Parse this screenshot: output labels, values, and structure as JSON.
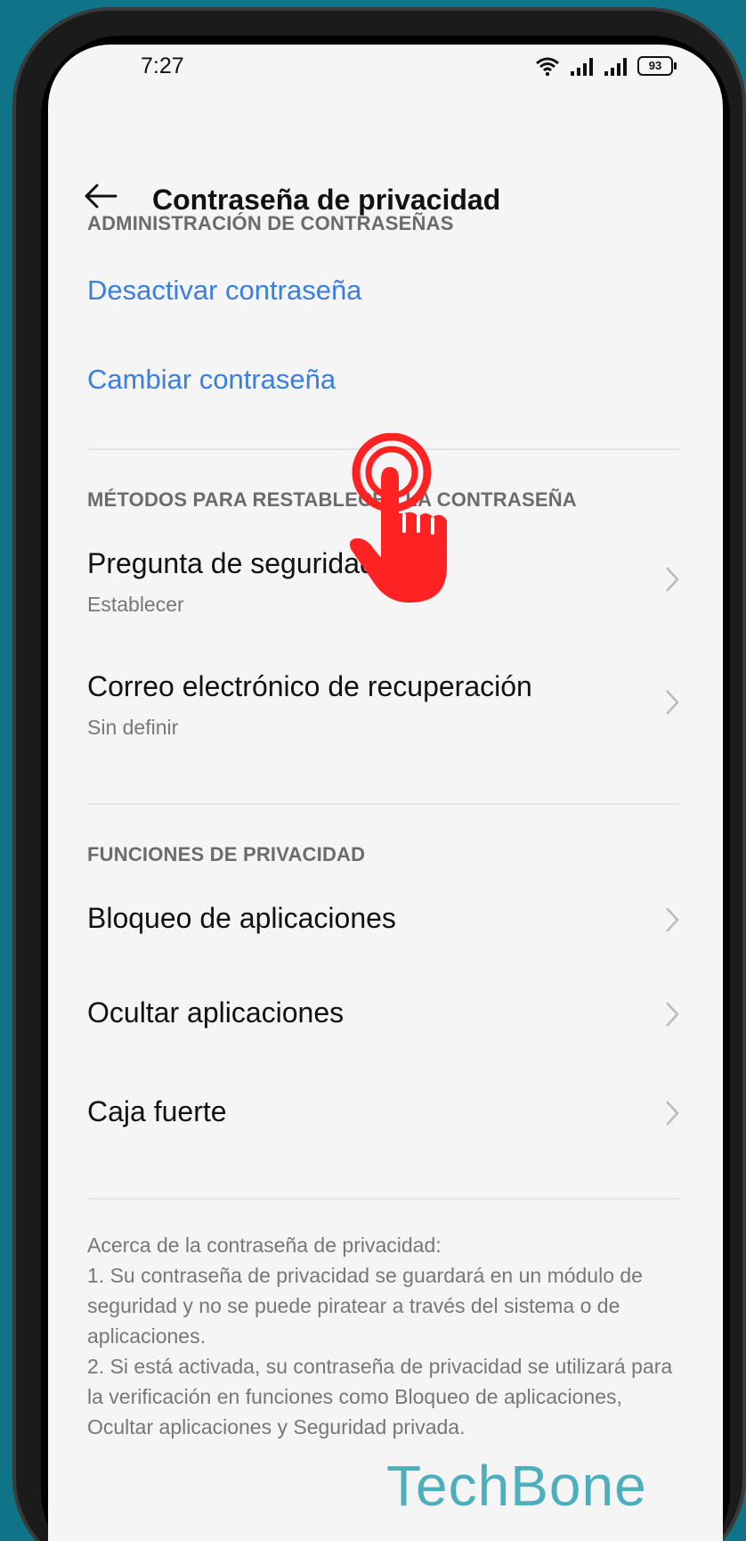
{
  "status_bar": {
    "time": "7:27",
    "battery": "93"
  },
  "header": {
    "title": "Contraseña de privacidad"
  },
  "section_password_admin": {
    "title": "ADMINISTRACIÓN DE CONTRASEÑAS",
    "deactivate": "Desactivar contraseña",
    "change": "Cambiar contraseña"
  },
  "section_recovery": {
    "title": "MÉTODOS PARA RESTABLECER LA CONTRASEÑA",
    "items": [
      {
        "title": "Pregunta de seguridad",
        "subtitle": "Establecer"
      },
      {
        "title": "Correo electrónico de recuperación",
        "subtitle": "Sin definir"
      }
    ]
  },
  "section_privacy": {
    "title": "FUNCIONES DE PRIVACIDAD",
    "items": [
      {
        "title": "Bloqueo de aplicaciones"
      },
      {
        "title": "Ocultar aplicaciones"
      },
      {
        "title": "Caja fuerte"
      }
    ]
  },
  "footer": {
    "line1": "Acerca de la contraseña de privacidad:",
    "line2": "1. Su contraseña de privacidad se guardará en un módulo de seguridad y no se puede piratear a través del sistema o de aplicaciones.",
    "line3": "2. Si está activada, su contraseña de privacidad se utilizará para la verificación en funciones como Bloqueo de aplicaciones, Ocultar aplicaciones y Seguridad privada."
  },
  "watermark": "TechBone",
  "colors": {
    "background": "#0f7488",
    "link": "#3a7fe0",
    "tap_indicator": "#ff2222"
  }
}
